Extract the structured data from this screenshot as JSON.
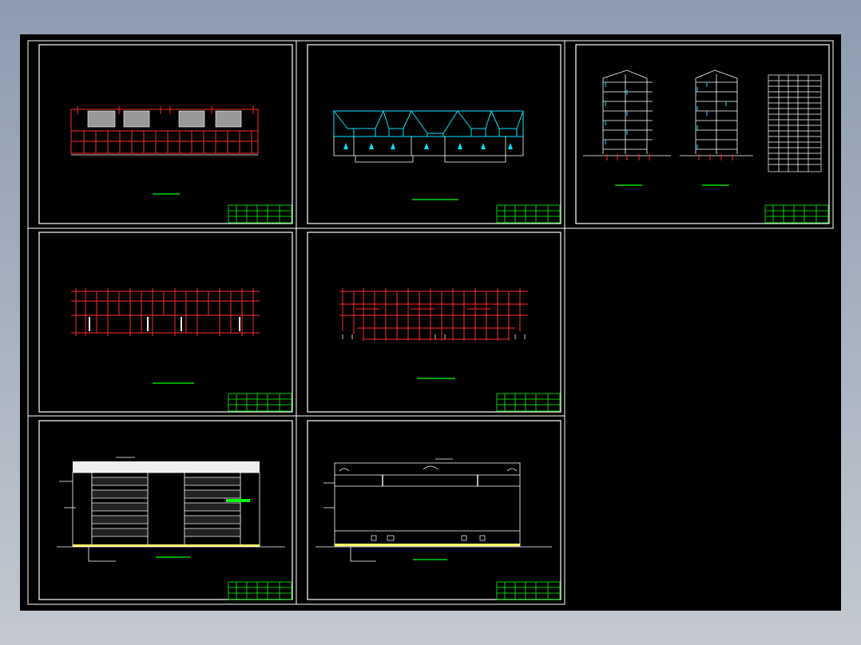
{
  "view": {
    "background": "#000000",
    "window_background": "#9aa6b6"
  },
  "colors": {
    "frame": "#ffffff",
    "wall": "#ff2a2a",
    "roof": "#00e5ff",
    "titleblock": "#00ff00",
    "caption": "#00ff00",
    "ground": "#ffff66",
    "hatch": "#bbbbbb"
  },
  "sheets": [
    {
      "id": "sheet-roof-plan",
      "kind": "roof-plan",
      "icon": "roof-plan-icon"
    },
    {
      "id": "sheet-roof-elevation",
      "kind": "roof-elevation",
      "icon": "roof-elevation-icon"
    },
    {
      "id": "sheet-sections",
      "kind": "sections-and-schedule",
      "icon": "section-icon"
    },
    {
      "id": "sheet-floor-plan-1",
      "kind": "floor-plan",
      "icon": "floor-plan-icon"
    },
    {
      "id": "sheet-floor-plan-2",
      "kind": "floor-plan",
      "icon": "floor-plan-icon"
    },
    {
      "id": "sheet-front-elevation",
      "kind": "elevation",
      "icon": "elevation-icon"
    },
    {
      "id": "sheet-rear-elevation",
      "kind": "elevation",
      "icon": "elevation-icon"
    }
  ]
}
